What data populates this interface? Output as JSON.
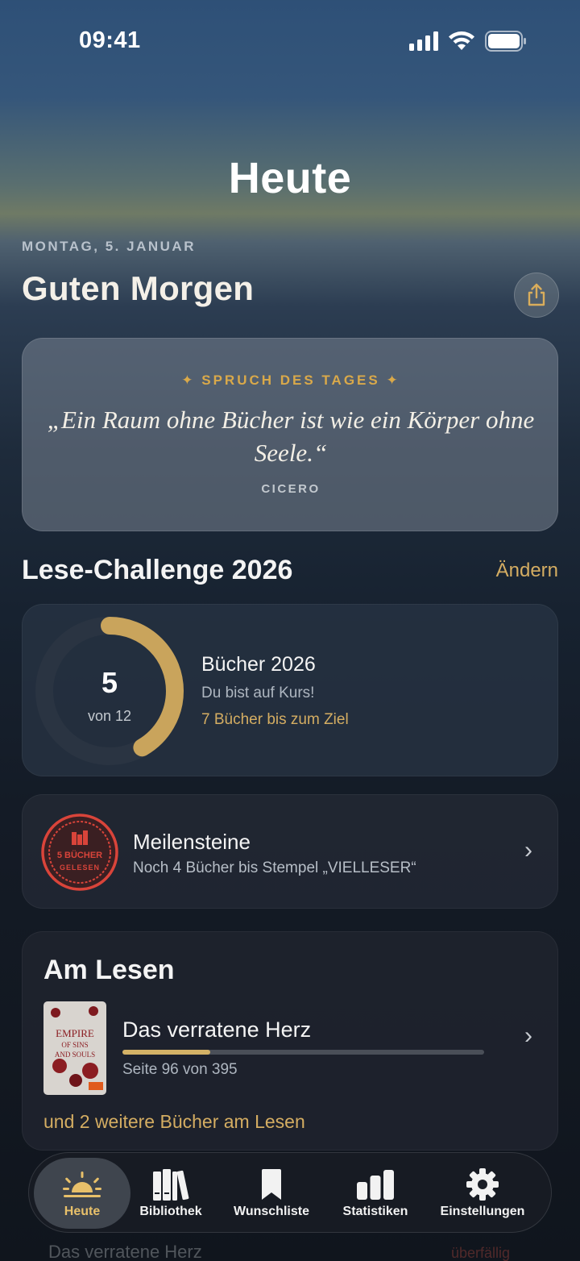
{
  "status_bar": {
    "time": "09:41"
  },
  "header": {
    "title": "Heute"
  },
  "date_line": "MONTAG, 5. JANUAR",
  "greeting": "Guten Morgen",
  "quote": {
    "label": "✦ SPRUCH DES TAGES ✦",
    "text": "„Ein Raum ohne Bücher ist wie ein Körper ohne Seele.“",
    "author": "CICERO"
  },
  "challenge": {
    "section_title": "Lese-Challenge 2026",
    "change_label": "Ändern",
    "count": "5",
    "of_label": "von 12",
    "read": 5,
    "goal": 12,
    "title": "Bücher 2026",
    "subtitle": "Du bist auf Kurs!",
    "remaining": "7 Bücher bis zum Ziel",
    "accent_color": "#c9a45c"
  },
  "milestones": {
    "title": "Meilensteine",
    "subtitle": "Noch 4 Bücher bis Stempel „VIELLESER“",
    "stamp_line1": "5 BÜCHER",
    "stamp_line2": "GELESEN",
    "stamp_color": "#d9443a"
  },
  "reading": {
    "section_title": "Am Lesen",
    "book_title": "Das verratene Herz",
    "pages_text": "Seite 96 von 395",
    "progress": 0.243,
    "more_text": "und 2 weitere Bücher am Lesen",
    "cover_title": "EMPIRE OF SINS AND SOULS"
  },
  "background_peek": {
    "left": "Das verratene Herz",
    "right": "überfällig"
  },
  "tabbar": {
    "items": [
      {
        "label": "Heute",
        "icon": "sunrise-icon",
        "active": true
      },
      {
        "label": "Bibliothek",
        "icon": "books-icon",
        "active": false
      },
      {
        "label": "Wunschliste",
        "icon": "bookmark-icon",
        "active": false
      },
      {
        "label": "Statistiken",
        "icon": "bar-chart-icon",
        "active": false
      },
      {
        "label": "Einstellungen",
        "icon": "gear-icon",
        "active": false
      }
    ]
  }
}
